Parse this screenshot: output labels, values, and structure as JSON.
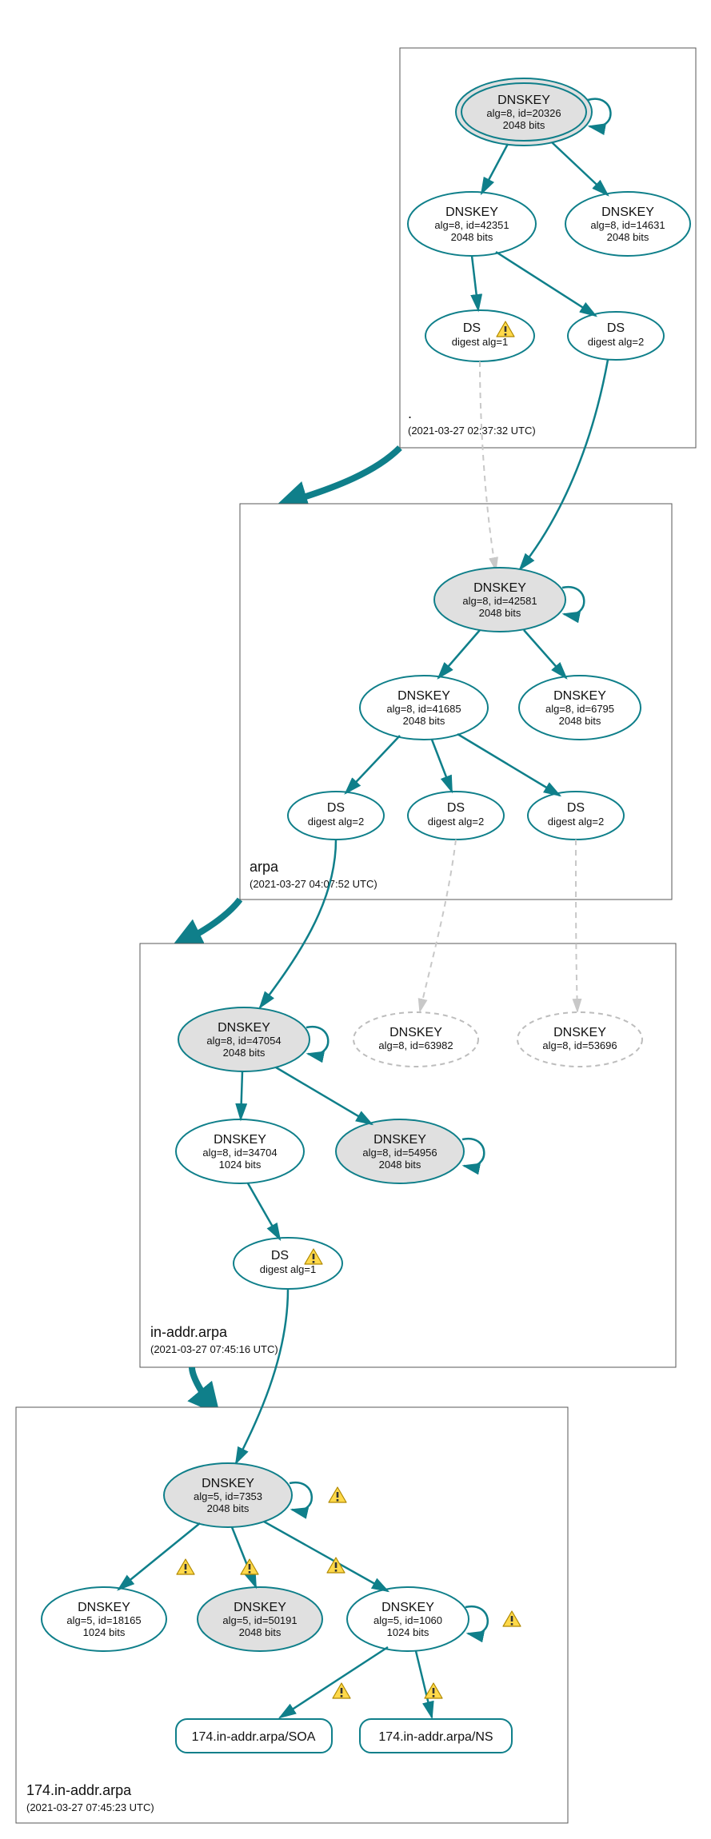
{
  "zones": {
    "root": {
      "name": ".",
      "ts": "(2021-03-27 02:37:32 UTC)"
    },
    "arpa": {
      "name": "arpa",
      "ts": "(2021-03-27 04:07:52 UTC)"
    },
    "inaddr": {
      "name": "in-addr.arpa",
      "ts": "(2021-03-27 07:45:16 UTC)"
    },
    "z174": {
      "name": "174.in-addr.arpa",
      "ts": "(2021-03-27 07:45:23 UTC)"
    }
  },
  "nodes": {
    "root_ksk": {
      "t": "DNSKEY",
      "s": "alg=8, id=20326",
      "b": "2048 bits"
    },
    "root_zsk1": {
      "t": "DNSKEY",
      "s": "alg=8, id=42351",
      "b": "2048 bits"
    },
    "root_zsk2": {
      "t": "DNSKEY",
      "s": "alg=8, id=14631",
      "b": "2048 bits"
    },
    "root_ds1": {
      "t": "DS",
      "s": "digest alg=1"
    },
    "root_ds2": {
      "t": "DS",
      "s": "digest alg=2"
    },
    "arpa_ksk": {
      "t": "DNSKEY",
      "s": "alg=8, id=42581",
      "b": "2048 bits"
    },
    "arpa_zsk1": {
      "t": "DNSKEY",
      "s": "alg=8, id=41685",
      "b": "2048 bits"
    },
    "arpa_zsk2": {
      "t": "DNSKEY",
      "s": "alg=8, id=6795",
      "b": "2048 bits"
    },
    "arpa_ds1": {
      "t": "DS",
      "s": "digest alg=2"
    },
    "arpa_ds2": {
      "t": "DS",
      "s": "digest alg=2"
    },
    "arpa_ds3": {
      "t": "DS",
      "s": "digest alg=2"
    },
    "in_ksk": {
      "t": "DNSKEY",
      "s": "alg=8, id=47054",
      "b": "2048 bits"
    },
    "in_zsk1": {
      "t": "DNSKEY",
      "s": "alg=8, id=34704",
      "b": "1024 bits"
    },
    "in_zsk2": {
      "t": "DNSKEY",
      "s": "alg=8, id=54956",
      "b": "2048 bits"
    },
    "in_gk1": {
      "t": "DNSKEY",
      "s": "alg=8, id=63982"
    },
    "in_gk2": {
      "t": "DNSKEY",
      "s": "alg=8, id=53696"
    },
    "in_ds": {
      "t": "DS",
      "s": "digest alg=1"
    },
    "z174_ksk": {
      "t": "DNSKEY",
      "s": "alg=5, id=7353",
      "b": "2048 bits"
    },
    "z174_k1": {
      "t": "DNSKEY",
      "s": "alg=5, id=18165",
      "b": "1024 bits"
    },
    "z174_k2": {
      "t": "DNSKEY",
      "s": "alg=5, id=50191",
      "b": "2048 bits"
    },
    "z174_k3": {
      "t": "DNSKEY",
      "s": "alg=5, id=1060",
      "b": "1024 bits"
    },
    "z174_soa": {
      "t": "174.in-addr.arpa/SOA"
    },
    "z174_ns": {
      "t": "174.in-addr.arpa/NS"
    }
  },
  "colors": {
    "accent": "#0f7f8a",
    "sep": "#e0e0e0",
    "muted": "#c8c8c8"
  }
}
